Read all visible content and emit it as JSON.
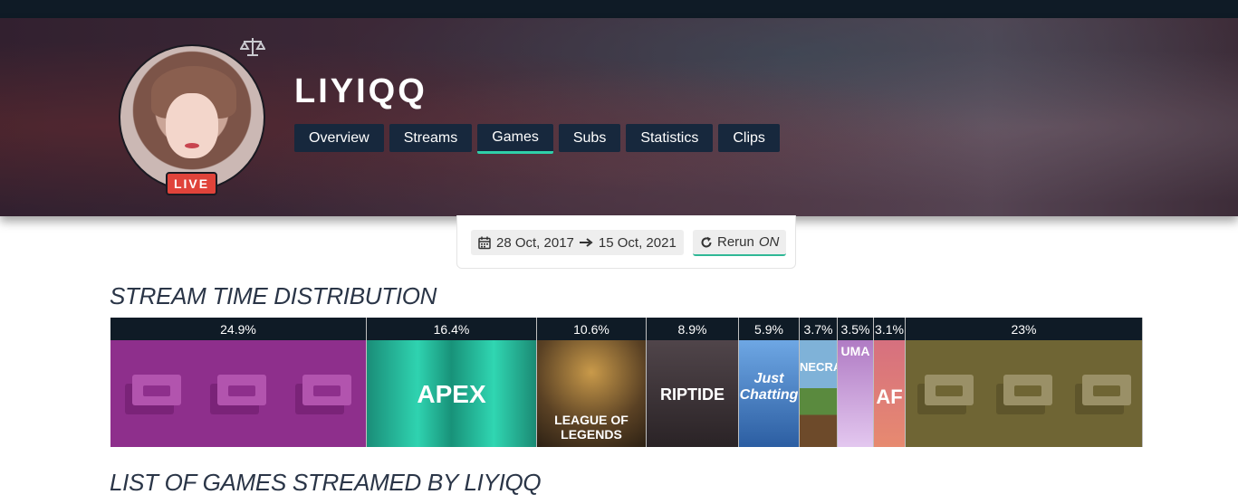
{
  "channel": {
    "name": "LIYIQQ",
    "live_label": "LIVE"
  },
  "nav": {
    "tabs": [
      {
        "label": "Overview"
      },
      {
        "label": "Streams"
      },
      {
        "label": "Games",
        "active": true
      },
      {
        "label": "Subs"
      },
      {
        "label": "Statistics"
      },
      {
        "label": "Clips"
      }
    ]
  },
  "filters": {
    "date_start": "28 Oct, 2017",
    "date_end": "15 Oct, 2021",
    "rerun_label": "Rerun",
    "rerun_state": "ON"
  },
  "sections": {
    "distribution_title": "STREAM TIME DISTRIBUTION",
    "games_list_title": "LIST OF GAMES STREAMED BY LIYIQQ"
  },
  "distribution": [
    {
      "pct_label": "24.9%",
      "share": 24.9,
      "cover": "unknown-game-placeholder",
      "color": "#8e2f8c"
    },
    {
      "pct_label": "16.4%",
      "share": 16.4,
      "cover": "apex-legends",
      "color": "#1fb196",
      "cover_text": "APEX"
    },
    {
      "pct_label": "10.6%",
      "share": 10.6,
      "cover": "league-of-legends",
      "color": "#6b5431",
      "cover_text": "LEAGUE OF LEGENDS"
    },
    {
      "pct_label": "8.9%",
      "share": 8.9,
      "cover": "counter-strike-riptide",
      "color": "#3a3236",
      "cover_text": "RIPTIDE"
    },
    {
      "pct_label": "5.9%",
      "share": 5.9,
      "cover": "just-chatting",
      "color": "#3a73b8",
      "cover_text": "Just Chatting"
    },
    {
      "pct_label": "3.7%",
      "share": 3.7,
      "cover": "minecraft",
      "color": "#4e7a3c",
      "cover_text": "NECRA"
    },
    {
      "pct_label": "3.5%",
      "share": 3.5,
      "cover": "human-fall-flat",
      "color": "#c6a6d9",
      "cover_text": "UMA"
    },
    {
      "pct_label": "3.1%",
      "share": 3.1,
      "cover": "party-animals",
      "color": "#d9596a",
      "cover_text": "AF"
    },
    {
      "pct_label": "23%",
      "share": 23,
      "cover": "unknown-game-placeholder",
      "color": "#6f6534"
    }
  ]
}
